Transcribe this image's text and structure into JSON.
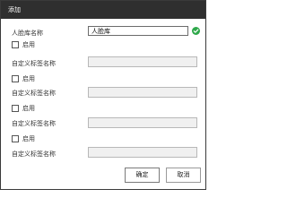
{
  "dialog": {
    "title": "添加"
  },
  "form": {
    "name_label": "人脸库名称",
    "name_value": "人脸库",
    "custom_tags": [
      {
        "enable_label": "启用",
        "tag_label": "自定义标签名称",
        "value": ""
      },
      {
        "enable_label": "启用",
        "tag_label": "自定义标签名称",
        "value": ""
      },
      {
        "enable_label": "启用",
        "tag_label": "自定义标签名称",
        "value": ""
      },
      {
        "enable_label": "启用",
        "tag_label": "自定义标签名称",
        "value": ""
      }
    ]
  },
  "buttons": {
    "confirm_label": "确定",
    "cancel_label": "取消"
  },
  "colors": {
    "titlebar": "#2f2f2f",
    "valid_icon": "#2ea84a"
  },
  "icons": {
    "valid": "check-circle-icon"
  }
}
